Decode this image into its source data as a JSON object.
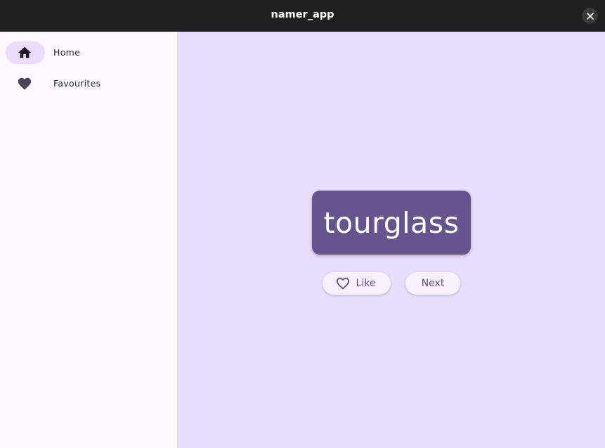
{
  "window": {
    "title": "namer_app"
  },
  "sidebar": {
    "items": [
      {
        "label": "Home",
        "icon": "home-icon",
        "selected": true
      },
      {
        "label": "Favourites",
        "icon": "heart-icon",
        "selected": false
      }
    ]
  },
  "main": {
    "word": "tourglass",
    "like_label": "Like",
    "next_label": "Next"
  },
  "colors": {
    "titlebar": "#202020",
    "sidebar_bg": "#fdf7fe",
    "main_bg": "#e9ddfe",
    "card": "#66548e",
    "selected_indicator": "#eadcfa",
    "button_text": "#5f4c8a"
  }
}
